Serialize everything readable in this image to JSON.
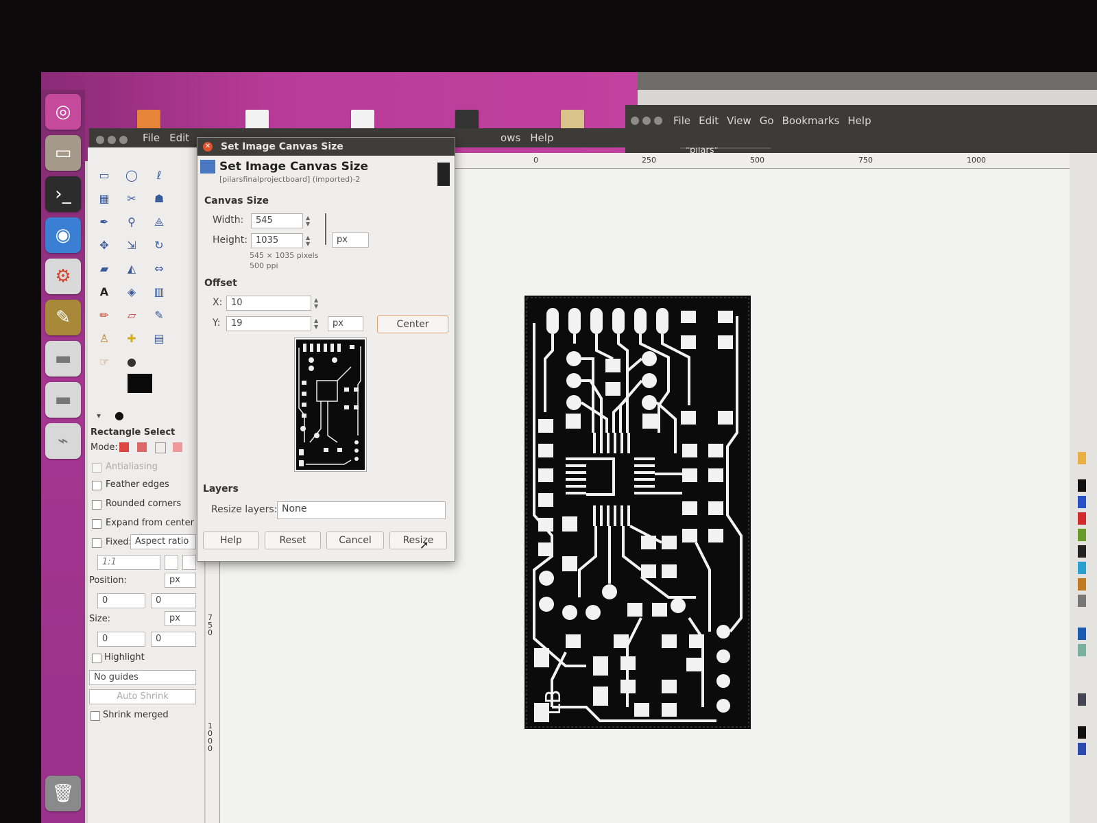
{
  "file_manager": {
    "menu": [
      "File",
      "Edit",
      "View",
      "Go",
      "Bookmarks",
      "Help"
    ],
    "search": "Search for \"pilars\""
  },
  "gimp": {
    "menu_left": [
      "File",
      "Edit"
    ],
    "menu_right": [
      "ows",
      "Help"
    ],
    "ruler_top": [
      "0",
      "250",
      "500",
      "750",
      "1000"
    ],
    "ruler_left": [
      "750",
      "1000"
    ]
  },
  "toolbox": {
    "tool_name": "Rectangle Select",
    "mode_label": "Mode:",
    "antialiasing": "Antialiasing",
    "feather_edges": "Feather edges",
    "rounded_corners": "Rounded corners",
    "expand_from_center": "Expand from center",
    "fixed_label": "Fixed:",
    "fixed_value": "Aspect ratio",
    "ratio_value": "1:1",
    "position_label": "Position:",
    "position_unit": "px",
    "position_x": "0",
    "position_y": "0",
    "size_label": "Size:",
    "size_unit": "px",
    "size_w": "0",
    "size_h": "0",
    "highlight": "Highlight",
    "guides": "No guides",
    "auto_shrink": "Auto Shrink",
    "shrink_merged": "Shrink merged"
  },
  "dialog": {
    "window_title": "Set Image Canvas Size",
    "heading": "Set Image Canvas Size",
    "subtitle": "[pilarsfinalprojectboard] (imported)-2",
    "canvas_size_label": "Canvas Size",
    "width_label": "Width:",
    "width_value": "545",
    "height_label": "Height:",
    "height_value": "1035",
    "unit": "px",
    "pixels_info": "545 × 1035 pixels",
    "ppi_info": "500 ppi",
    "offset_label": "Offset",
    "x_label": "X:",
    "x_value": "10",
    "y_label": "Y:",
    "y_value": "19",
    "offset_unit": "px",
    "center_button": "Center",
    "layers_label": "Layers",
    "resize_layers_label": "Resize layers:",
    "resize_layers_value": "None",
    "help_button": "Help",
    "reset_button": "Reset",
    "cancel_button": "Cancel",
    "resize_button": "Resize"
  },
  "pcb_label": "LB",
  "colors": {
    "launcher": "#a43690",
    "title_bar": "#3c3b37",
    "close_button": "#e0522b",
    "center_button_border": "#e0a070"
  }
}
